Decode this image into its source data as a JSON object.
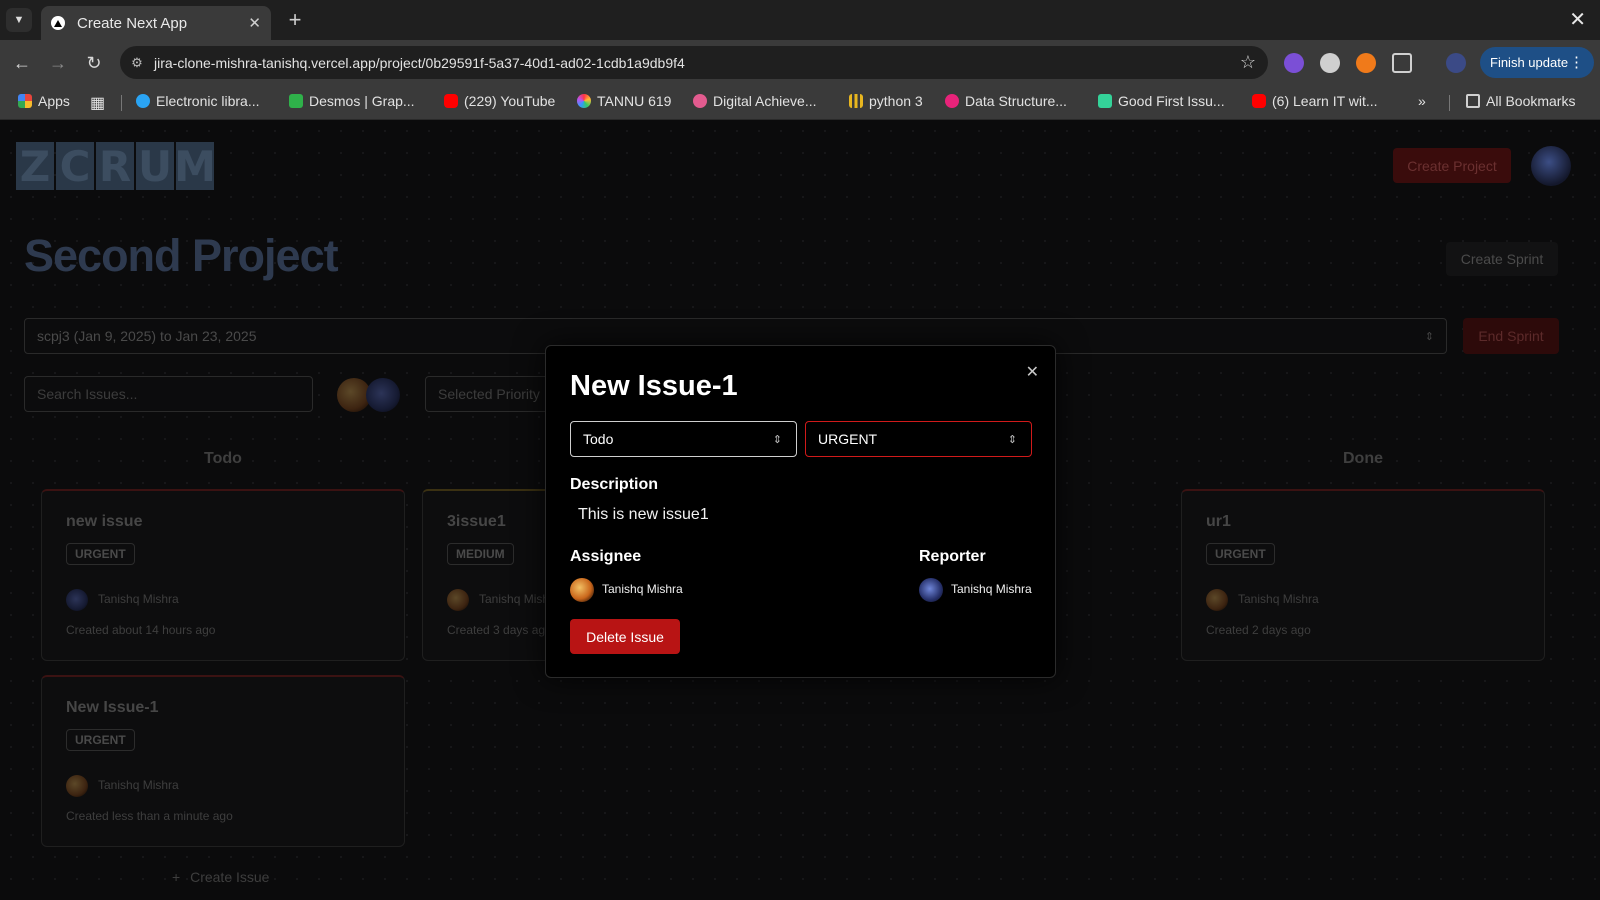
{
  "browser": {
    "tab_title": "Create Next App",
    "url": "jira-clone-mishra-tanishq.vercel.app/project/0b29591f-5a37-40d1-ad02-1cdb1a9db9f4",
    "finish_update_label": "Finish update",
    "bookmarks": [
      {
        "label": "Apps",
        "icon": "apps-grid-icon",
        "color": "#e8453c"
      },
      {
        "label": "Electronic libra...",
        "icon": "globe-icon",
        "color": "#2aa4f4"
      },
      {
        "label": "Desmos | Grap...",
        "icon": "desmos-icon",
        "color": "#2fb14a"
      },
      {
        "label": "(229) YouTube",
        "icon": "youtube-icon",
        "color": "#ff0000"
      },
      {
        "label": "TANNU 619",
        "icon": "rainbow-icon",
        "color": "#b75be8"
      },
      {
        "label": "Digital Achieve...",
        "icon": "badge-icon",
        "color": "#e35b8f"
      },
      {
        "label": "python 3",
        "icon": "chart-icon",
        "color": "#e8b61f"
      },
      {
        "label": "Data Structure...",
        "icon": "pink-circle-icon",
        "color": "#e8237a"
      },
      {
        "label": "Good First Issu...",
        "icon": "gfi-icon",
        "color": "#34d399"
      },
      {
        "label": "(6) Learn IT wit...",
        "icon": "youtube-icon",
        "color": "#ff0000"
      }
    ],
    "all_bookmarks_label": "All Bookmarks"
  },
  "app": {
    "logo_letters": [
      "Z",
      "C",
      "R",
      "U",
      "M"
    ],
    "create_project_label": "Create Project",
    "project_title": "Second Project",
    "create_sprint_label": "Create Sprint",
    "sprint_select_value": "scpj3 (Jan 9, 2025) to Jan 23, 2025",
    "end_sprint_label": "End Sprint",
    "search_placeholder": "Search Issues...",
    "priority_placeholder": "Selected Priority",
    "columns": {
      "todo": "Todo",
      "done": "Done"
    },
    "cards": [
      {
        "title": "new issue",
        "priority": "URGENT",
        "user": "Tanishq Mishra",
        "created": "Created about 14 hours ago"
      },
      {
        "title": "New Issue-1",
        "priority": "URGENT",
        "user": "Tanishq Mishra",
        "created": "Created less than a minute ago"
      },
      {
        "title": "3issue1",
        "priority": "MEDIUM",
        "user": "Tanishq Mish",
        "created": "Created 3 days ag"
      },
      {
        "title": "ur1",
        "priority": "URGENT",
        "user": "Tanishq Mishra",
        "created": "Created 2 days ago"
      }
    ],
    "create_issue_label": "Create Issue"
  },
  "modal": {
    "title": "New Issue-1",
    "status_value": "Todo",
    "priority_value": "URGENT",
    "description_label": "Description",
    "description_text": "This is new issue1",
    "assignee_label": "Assignee",
    "assignee_name": "Tanishq Mishra",
    "reporter_label": "Reporter",
    "reporter_name": "Tanishq Mishra",
    "delete_label": "Delete Issue",
    "accent_color": "#b81414"
  }
}
